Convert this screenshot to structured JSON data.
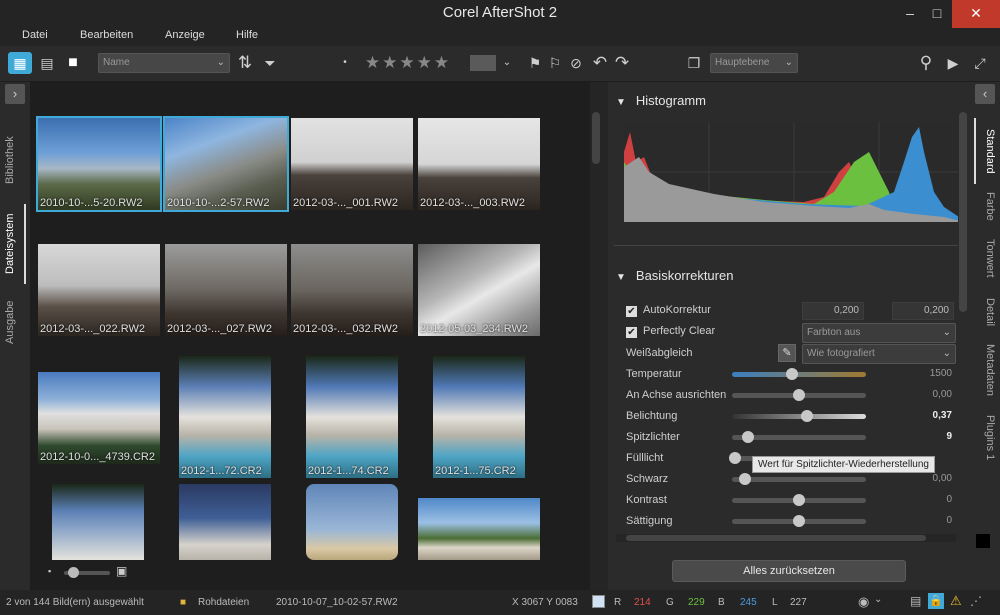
{
  "app": {
    "title": "Corel AfterShot 2"
  },
  "window_controls": {
    "minimize": "–",
    "maximize": "□",
    "close": "✕"
  },
  "menu": [
    "Datei",
    "Bearbeiten",
    "Anzeige",
    "Hilfe"
  ],
  "toolbar": {
    "sort_select": "Name",
    "layer_select": "Hauptebene",
    "rating_stars": 5
  },
  "left_tabs": [
    "Bibliothek",
    "Dateisystem",
    "Ausgabe"
  ],
  "right_tabs": [
    "Standard",
    "Farbe",
    "Tonwert",
    "Detail",
    "Metadaten",
    "Plugins 1"
  ],
  "thumbnails": [
    {
      "caption": "2010-10-...5-20.RW2",
      "selected": true
    },
    {
      "caption": "2010-10-...2-57.RW2",
      "selected": true
    },
    {
      "caption": "2012-03-..._001.RW2",
      "selected": false
    },
    {
      "caption": "2012-03-..._003.RW2",
      "selected": false
    },
    {
      "caption": "2012-03-..._022.RW2",
      "selected": false
    },
    {
      "caption": "2012-03-..._027.RW2",
      "selected": false
    },
    {
      "caption": "2012-03-..._032.RW2",
      "selected": false
    },
    {
      "caption": "2012-05-03_234.RW2",
      "selected": false
    },
    {
      "caption": "2012-10-0..._4739.CR2",
      "selected": false
    },
    {
      "caption": "2012-1...72.CR2",
      "selected": false
    },
    {
      "caption": "2012-1...74.CR2",
      "selected": false
    },
    {
      "caption": "2012-1...75.CR2",
      "selected": false
    },
    {
      "caption": "",
      "selected": false
    },
    {
      "caption": "",
      "selected": false
    },
    {
      "caption": "",
      "selected": false
    },
    {
      "caption": "",
      "selected": false
    }
  ],
  "histogram": {
    "title": "Histogramm"
  },
  "basic": {
    "title": "Basiskorrekturen",
    "autokorrektur": {
      "label": "AutoKorrektur",
      "v1": "0,200",
      "v2": "0,200"
    },
    "perfectly_clear": {
      "label": "Perfectly Clear",
      "select": "Farbton aus"
    },
    "weissabgleich": {
      "label": "Weißabgleich",
      "select": "Wie fotografiert"
    },
    "sliders": [
      {
        "label": "Temperatur",
        "value": "1500",
        "pos": 0.45
      },
      {
        "label": "An Achse ausrichten",
        "value": "0,00",
        "pos": 0.5
      },
      {
        "label": "Belichtung",
        "value": "0,37",
        "pos": 0.56
      },
      {
        "label": "Spitzlichter",
        "value": "9",
        "pos": 0.12
      },
      {
        "label": "Fülllicht",
        "value": "",
        "pos": 0.02
      },
      {
        "label": "Schwarz",
        "value": "0,00",
        "pos": 0.1
      },
      {
        "label": "Kontrast",
        "value": "0",
        "pos": 0.5
      },
      {
        "label": "Sättigung",
        "value": "0",
        "pos": 0.5
      }
    ],
    "tooltip": "Wert für Spitzlichter-Wiederherstellung"
  },
  "reset_button": "Alles zurücksetzen",
  "status": {
    "selection": "2 von 144 Bild(ern) ausgewählt",
    "folder": "Rohdateien",
    "file": "2010-10-07_10-02-57.RW2",
    "coords": "X 3067  Y 0083",
    "r_label": "R",
    "r": "214",
    "g_label": "G",
    "g": "229",
    "b_label": "B",
    "b": "245",
    "l_label": "L",
    "l": "227"
  },
  "colors": {
    "accent": "#3fa9d8",
    "red": "#d04040",
    "green": "#6cc040",
    "blue": "#3b8fd0"
  }
}
